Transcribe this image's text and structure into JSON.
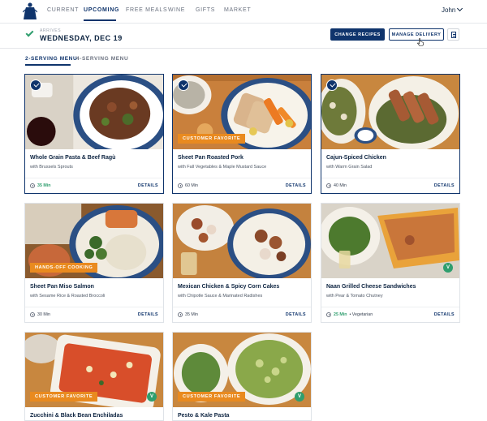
{
  "nav": {
    "items": [
      "CURRENT",
      "UPCOMING",
      "FREE MEALS",
      "WINE",
      "GIFTS",
      "MARKET"
    ],
    "active": "UPCOMING",
    "user": "John"
  },
  "delivery": {
    "label": "ARRIVES",
    "date": "WEDNESDAY, DEC 19",
    "change_recipes": "CHANGE RECIPES",
    "manage_delivery": "MANAGE DELIVERY"
  },
  "tabs": [
    "2-SERVING MENU",
    "4-SERVING MENU"
  ],
  "cards": [
    {
      "title": "Whole Grain Pasta & Beef Ragù",
      "subtitle": "with Brussels Sprouts",
      "time": "35 Min",
      "time_green": true,
      "badge": "",
      "selected": true,
      "veg": false,
      "extra": ""
    },
    {
      "title": "Sheet Pan Roasted Pork",
      "subtitle": "with Fall Vegetables & Maple Mustard Sauce",
      "time": "60 Min",
      "time_green": false,
      "badge": "CUSTOMER FAVORITE",
      "selected": true,
      "veg": false,
      "extra": ""
    },
    {
      "title": "Cajun-Spiced Chicken",
      "subtitle": "with Warm Grain Salad",
      "time": "40 Min",
      "time_green": false,
      "badge": "",
      "selected": true,
      "veg": false,
      "extra": ""
    },
    {
      "title": "Sheet Pan Miso Salmon",
      "subtitle": "with Sesame Rice & Roasted Broccoli",
      "time": "30 Min",
      "time_green": false,
      "badge": "HANDS-OFF COOKING",
      "selected": false,
      "veg": false,
      "extra": ""
    },
    {
      "title": "Mexican Chicken & Spicy Corn Cakes",
      "subtitle": "with Chipotle Sauce & Marinated Radishes",
      "time": "35 Min",
      "time_green": false,
      "badge": "",
      "selected": false,
      "veg": false,
      "extra": ""
    },
    {
      "title": "Naan Grilled Cheese Sandwiches",
      "subtitle": "with Pear & Tomato Chutney",
      "time": "25 Min",
      "time_green": true,
      "badge": "",
      "selected": false,
      "veg": true,
      "extra": "• Vegetarian"
    },
    {
      "title": "Zucchini & Black Bean Enchiladas",
      "subtitle": "",
      "time": "",
      "time_green": false,
      "badge": "CUSTOMER FAVORITE",
      "selected": false,
      "veg": true,
      "extra": ""
    },
    {
      "title": "Pesto & Kale Pasta",
      "subtitle": "",
      "time": "",
      "time_green": false,
      "badge": "CUSTOMER FAVORITE",
      "selected": false,
      "veg": true,
      "extra": ""
    }
  ],
  "details_label": "DETAILS",
  "veg_symbol": "V",
  "colors": {
    "brand_navy": "#0f346c",
    "badge_orange": "#e98a1f",
    "green": "#2f9e6e"
  }
}
